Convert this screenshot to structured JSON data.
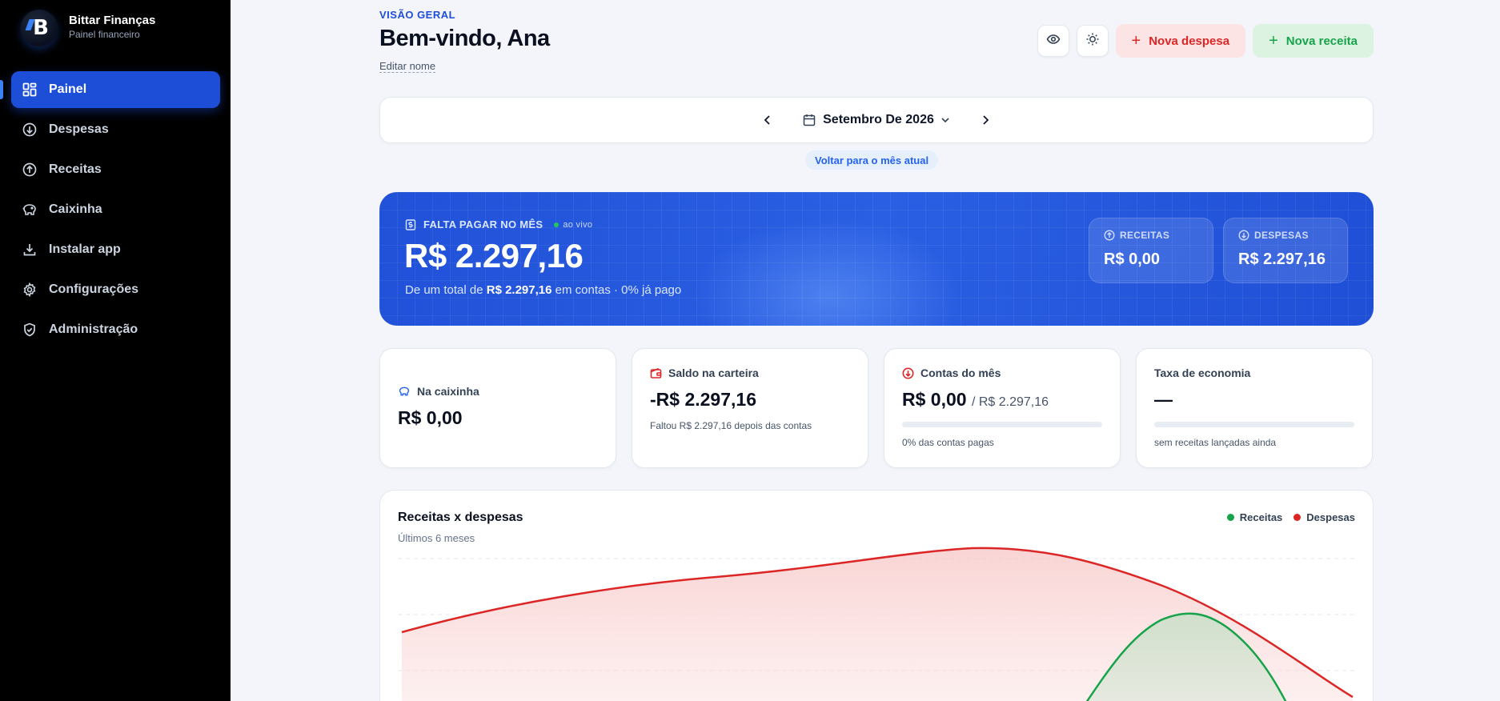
{
  "brand": {
    "title": "Bittar Finanças",
    "subtitle": "Painel financeiro"
  },
  "nav": [
    {
      "label": "Painel",
      "icon": "dashboard-icon",
      "active": true
    },
    {
      "label": "Despesas",
      "icon": "arrow-down-circle-icon"
    },
    {
      "label": "Receitas",
      "icon": "arrow-up-circle-icon"
    },
    {
      "label": "Caixinha",
      "icon": "piggy-bank-icon"
    },
    {
      "label": "Instalar app",
      "icon": "download-icon"
    },
    {
      "label": "Configurações",
      "icon": "gear-icon"
    },
    {
      "label": "Administração",
      "icon": "shield-icon"
    }
  ],
  "header": {
    "overline": "VISÃO GERAL",
    "title": "Bem-vindo, Ana",
    "edit_name": "Editar nome",
    "new_expense": "Nova despesa",
    "new_income": "Nova receita"
  },
  "month": {
    "label": "Setembro De 2026",
    "back_to_current": "Voltar para o mês atual"
  },
  "hero": {
    "label": "FALTA PAGAR NO MÊS",
    "live": "ao vivo",
    "amount": "R$ 2.297,16",
    "sub_prefix": "De um total de",
    "sub_total": "R$ 2.297,16",
    "sub_suffix": "em contas · 0% já pago",
    "income_label": "RECEITAS",
    "income_value": "R$ 0,00",
    "expense_label": "DESPESAS",
    "expense_value": "R$ 2.297,16"
  },
  "stats": {
    "piggy": {
      "label": "Na caixinha",
      "value": "R$ 0,00"
    },
    "wallet": {
      "label": "Saldo na carteira",
      "value": "-R$ 2.297,16",
      "note": "Faltou R$ 2.297,16 depois das contas"
    },
    "bills": {
      "label": "Contas do mês",
      "value": "R$ 0,00",
      "of": "/ R$ 2.297,16",
      "note": "0% das contas pagas",
      "progress": 0
    },
    "savings": {
      "label": "Taxa de economia",
      "value": "—",
      "note": "sem receitas lançadas ainda",
      "progress": 0
    }
  },
  "chart": {
    "title": "Receitas x despesas",
    "subtitle": "Últimos 6 meses",
    "legend_income": "Receitas",
    "legend_expense": "Despesas"
  },
  "colors": {
    "primary": "#1d4ed8",
    "income": "#16a34a",
    "expense": "#dc2626"
  }
}
